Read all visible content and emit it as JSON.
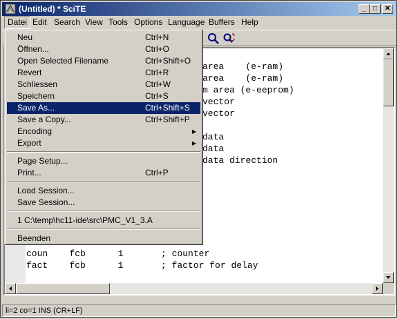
{
  "window": {
    "title": "(Untitled) * SciTE",
    "minimize": "_",
    "maximize": "□",
    "close": "✕"
  },
  "menubar": [
    "Datei",
    "Edit",
    "Search",
    "View",
    "Tools",
    "Options",
    "Language",
    "Buffers",
    "Help"
  ],
  "toolbar": {
    "icons": [
      "find-icon",
      "replace-icon"
    ]
  },
  "editor": {
    "visible_lines": [
      "area    (e-ram)",
      "area    (e-ram)",
      "m area (e-eeprom)",
      "vector",
      "vector",
      "",
      "data",
      "data",
      "data direction"
    ],
    "bottom_lines": [
      "coun    fcb      1       ; counter",
      "fact    fcb      1       ; factor for delay"
    ]
  },
  "file_menu": {
    "items": [
      {
        "label": "Neu",
        "shortcut": "Ctrl+N"
      },
      {
        "label": "Öffnen...",
        "shortcut": "Ctrl+O"
      },
      {
        "label": "Open Selected Filename",
        "shortcut": "Ctrl+Shift+O"
      },
      {
        "label": "Revert",
        "shortcut": "Ctrl+R"
      },
      {
        "label": "Schliessen",
        "shortcut": "Ctrl+W"
      },
      {
        "label": "Speichern",
        "shortcut": "Ctrl+S"
      },
      {
        "label": "Save As...",
        "shortcut": "Ctrl+Shift+S"
      },
      {
        "label": "Save a Copy...",
        "shortcut": "Ctrl+Shift+P"
      },
      {
        "label": "Encoding",
        "shortcut": ""
      },
      {
        "label": "Export",
        "shortcut": ""
      },
      {
        "label": "Page Setup...",
        "shortcut": ""
      },
      {
        "label": "Print...",
        "shortcut": "Ctrl+P"
      },
      {
        "label": "Load Session...",
        "shortcut": ""
      },
      {
        "label": "Save Session...",
        "shortcut": ""
      },
      {
        "label": "1 C:\\temp\\hc11-ide\\src\\PMC_V1_3.A",
        "shortcut": ""
      },
      {
        "label": "Beenden",
        "shortcut": ""
      }
    ],
    "selected": "Save As...",
    "submenu_arrow": "▶"
  },
  "status": {
    "text": "li=2 co=1 INS (CR+LF)"
  },
  "colors": {
    "titlebar": "#0a246a",
    "selection": "#0a246a",
    "face": "#d4d0c8"
  }
}
